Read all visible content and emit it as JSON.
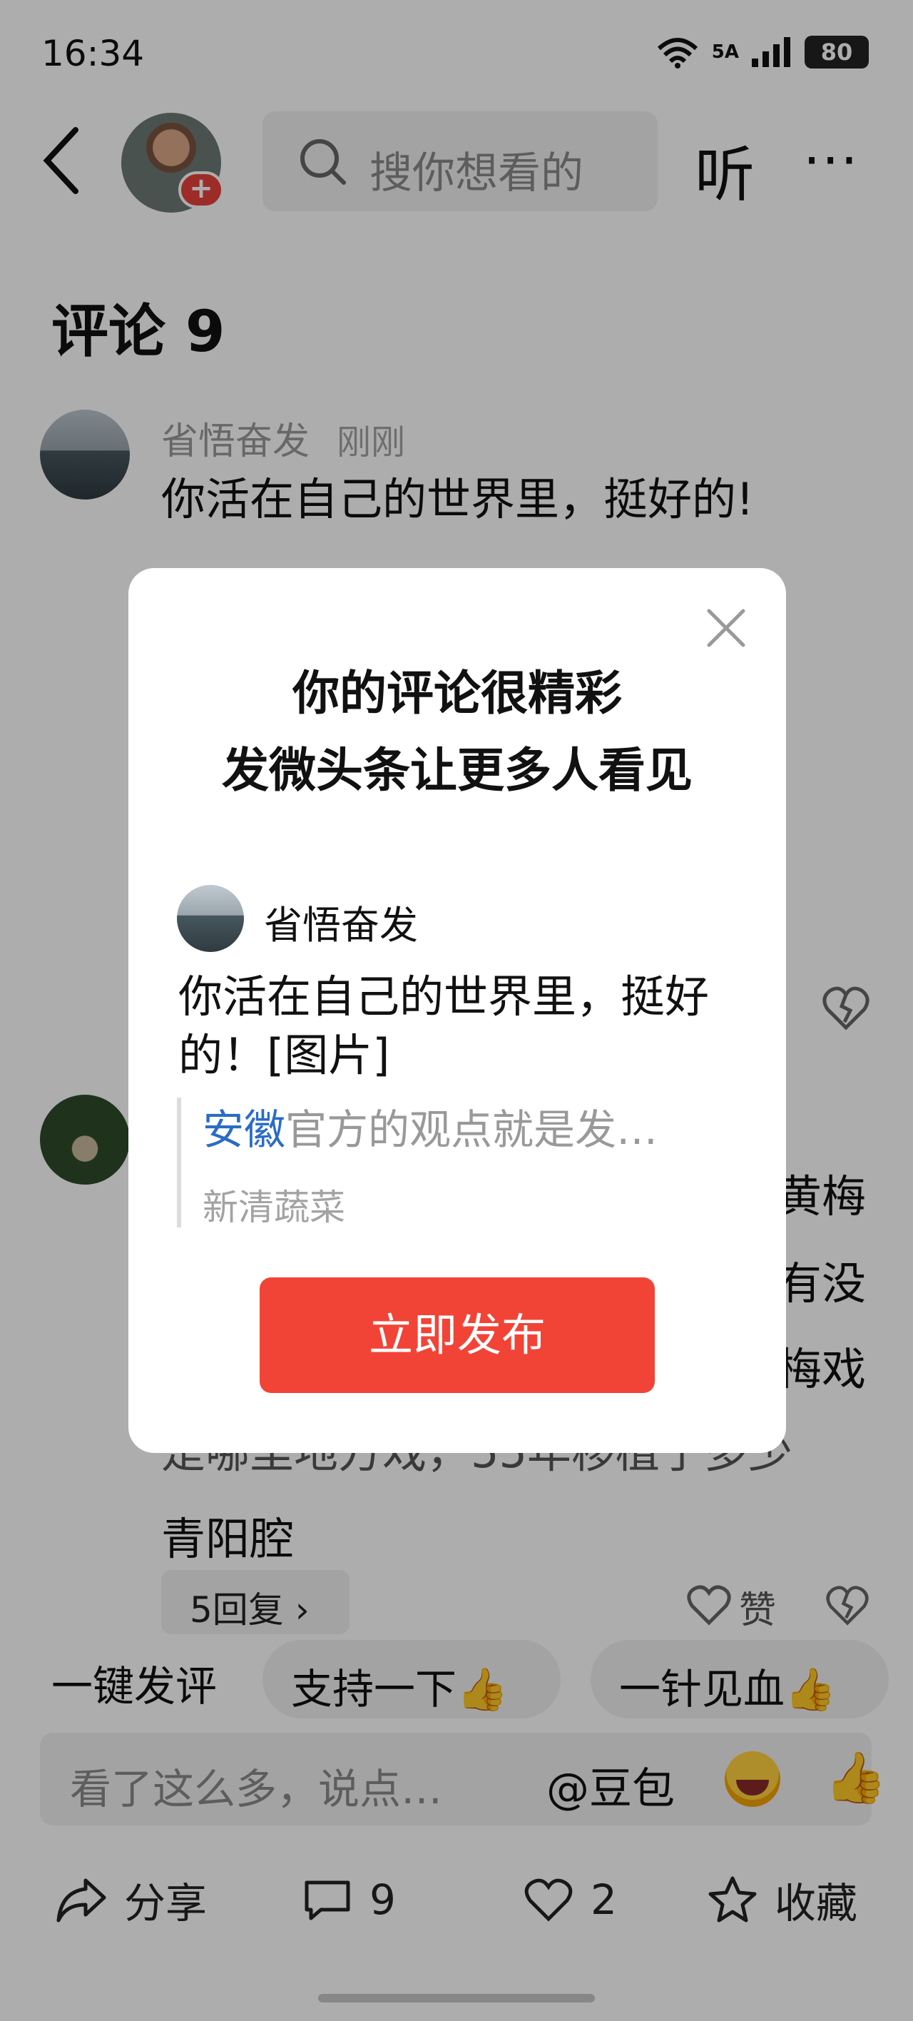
{
  "status_bar": {
    "time": "16:34",
    "wifi_label": "6",
    "signal_label": "5A",
    "battery": "80"
  },
  "nav": {
    "search_placeholder": "搜你想看的",
    "listen_label": "听",
    "more_label": "···"
  },
  "comments": {
    "title": "评论 9",
    "items": [
      {
        "name": "省悟奋发",
        "time": "刚刚",
        "text": "你活在自己的世界里，挺好的!"
      }
    ],
    "partial_lines": [
      "黄梅",
      "有没",
      "梅戏",
      "是哪里地方戏，55年移植了多少",
      "青阳腔"
    ],
    "replies_label": "5回复 ›",
    "like_label": "赞"
  },
  "quick_replies": {
    "label": "一键发评",
    "chips": [
      "支持一下",
      "一针见血"
    ],
    "thumb": "👍"
  },
  "input": {
    "placeholder": "看了这么多，说点…",
    "mention": "@豆包"
  },
  "actions": {
    "share": "分享",
    "comments_count": "9",
    "likes_count": "2",
    "favorite": "收藏"
  },
  "modal": {
    "title_line1": "你的评论很精彩",
    "title_line2": "发微头条让更多人看见",
    "author": "省悟奋发",
    "text": "你活在自己的世界里，挺好的！[图片]",
    "quote_link": "安徽",
    "quote_rest": "官方的观点就是发…",
    "quote_author": "新清蔬菜",
    "publish_button": "立即发布"
  }
}
